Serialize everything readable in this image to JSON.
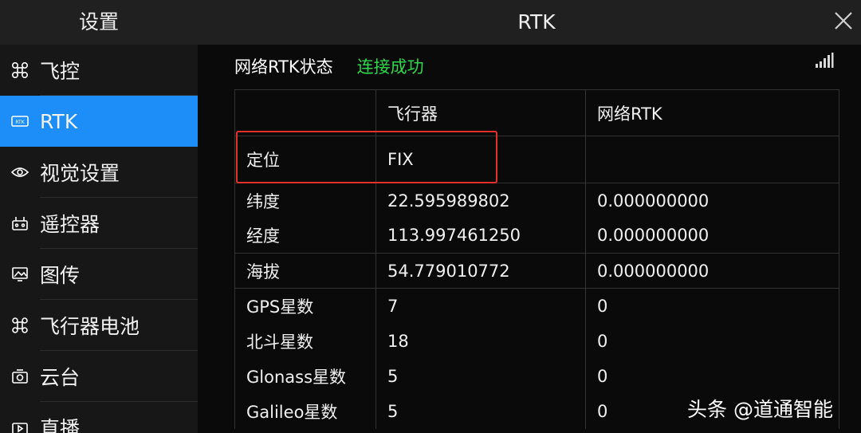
{
  "header": {
    "left_title": "设置",
    "title": "RTK",
    "close_icon": "close-icon"
  },
  "sidebar": {
    "active_color": "#1d8df7",
    "items": [
      {
        "label": "飞控",
        "icon": "drone-icon",
        "active": false
      },
      {
        "label": "RTK",
        "icon": "rtk-icon",
        "active": true
      },
      {
        "label": "视觉设置",
        "icon": "eye-icon",
        "active": false
      },
      {
        "label": "遥控器",
        "icon": "remote-controller-icon",
        "active": false
      },
      {
        "label": "图传",
        "icon": "image-transmission-icon",
        "active": false
      },
      {
        "label": "飞行器电池",
        "icon": "aircraft-battery-icon",
        "active": false
      },
      {
        "label": "云台",
        "icon": "gimbal-camera-icon",
        "active": false
      },
      {
        "label": "直播",
        "icon": "live-stream-icon",
        "active": false
      }
    ]
  },
  "status": {
    "label": "网络RTK状态",
    "value": "连接成功",
    "value_color": "#2fd74a",
    "signal_icon": "signal-bars-icon"
  },
  "table": {
    "headers": [
      "",
      "飞行器",
      "网络RTK"
    ],
    "rows": [
      {
        "label": "定位",
        "aircraft": "FIX",
        "network": ""
      },
      {
        "label": "纬度",
        "aircraft": "22.595989802",
        "network": "0.000000000"
      },
      {
        "label": "经度",
        "aircraft": "113.997461250",
        "network": "0.000000000"
      },
      {
        "label": "海拔",
        "aircraft": "54.779010772",
        "network": "0.000000000"
      },
      {
        "label": "GPS星数",
        "aircraft": "7",
        "network": "0"
      },
      {
        "label": "北斗星数",
        "aircraft": "18",
        "network": "0"
      },
      {
        "label": "Glonass星数",
        "aircraft": "5",
        "network": "0"
      },
      {
        "label": "Galileo星数",
        "aircraft": "5",
        "network": "0"
      }
    ],
    "highlight_color": "#e4302a"
  },
  "watermark": "头条 @道通智能"
}
